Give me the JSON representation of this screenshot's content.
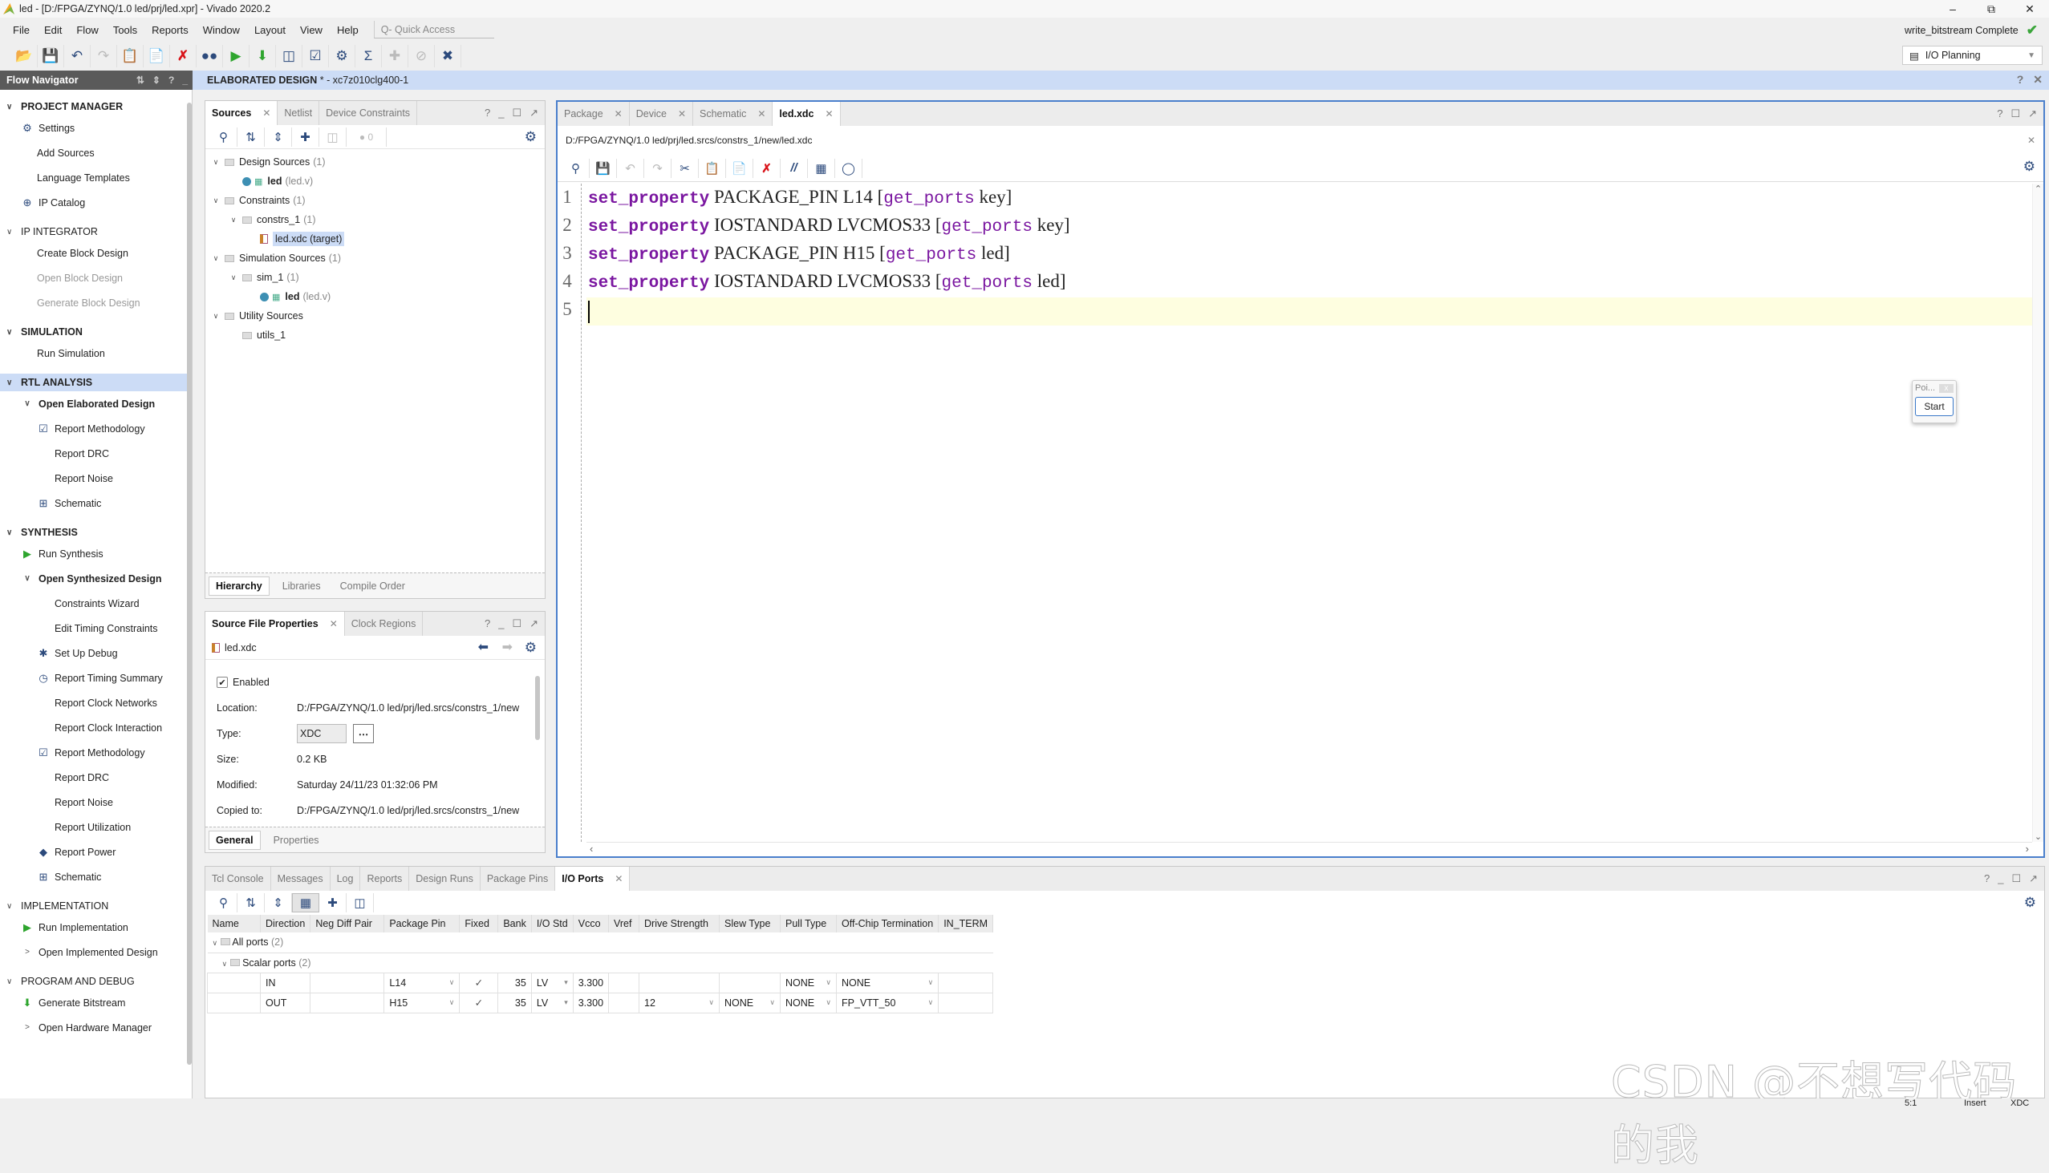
{
  "window": {
    "title": "led - [D:/FPGA/ZYNQ/1.0 led/prj/led.xpr] - Vivado 2020.2",
    "controls": [
      "minimize-icon",
      "restore-icon",
      "close-icon"
    ]
  },
  "menu": {
    "items": [
      "File",
      "Edit",
      "Flow",
      "Tools",
      "Reports",
      "Window",
      "Layout",
      "View",
      "Help"
    ],
    "quick_access_placeholder": "Q- Quick Access"
  },
  "status": {
    "run_status": "write_bitstream Complete",
    "layout_selector": "I/O Planning"
  },
  "toolbar": {
    "buttons": [
      "open-project",
      "save",
      "undo",
      "redo",
      "copy",
      "paste",
      "delete",
      "find",
      "run",
      "generate-bitstream",
      "schematic",
      "report",
      "settings",
      "sigma",
      "disabled-1",
      "disabled-2",
      "close-design"
    ]
  },
  "header": {
    "flow_navigator": "Flow Navigator",
    "design_title": "ELABORATED DESIGN",
    "design_part": " * - xc7z010clg400-1"
  },
  "flow_navigator": {
    "sections": [
      {
        "title": "PROJECT MANAGER",
        "items": [
          {
            "label": "Settings",
            "icon": "gear-icon"
          },
          {
            "label": "Add Sources"
          },
          {
            "label": "Language Templates"
          },
          {
            "label": "IP Catalog",
            "icon": "ip-icon"
          }
        ]
      },
      {
        "title": "IP INTEGRATOR",
        "items": [
          {
            "label": "Create Block Design"
          },
          {
            "label": "Open Block Design",
            "disabled": true
          },
          {
            "label": "Generate Block Design",
            "disabled": true
          }
        ]
      },
      {
        "title": "SIMULATION",
        "items": [
          {
            "label": "Run Simulation"
          }
        ]
      },
      {
        "title": "RTL ANALYSIS",
        "active": true,
        "items": [
          {
            "label": "Open Elaborated Design",
            "expanded": true
          },
          {
            "label": "Report Methodology",
            "icon": "clipboard-icon"
          },
          {
            "label": "Report DRC"
          },
          {
            "label": "Report Noise"
          },
          {
            "label": "Schematic",
            "icon": "schematic-icon"
          }
        ]
      },
      {
        "title": "SYNTHESIS",
        "items": [
          {
            "label": "Run Synthesis",
            "icon": "play-icon"
          },
          {
            "label": "Open Synthesized Design",
            "expanded": true
          },
          {
            "label": "Constraints Wizard"
          },
          {
            "label": "Edit Timing Constraints"
          },
          {
            "label": "Set Up Debug",
            "icon": "bug-icon"
          },
          {
            "label": "Report Timing Summary",
            "icon": "clock-icon"
          },
          {
            "label": "Report Clock Networks"
          },
          {
            "label": "Report Clock Interaction"
          },
          {
            "label": "Report Methodology",
            "icon": "clipboard-icon"
          },
          {
            "label": "Report DRC"
          },
          {
            "label": "Report Noise"
          },
          {
            "label": "Report Utilization"
          },
          {
            "label": "Report Power",
            "icon": "power-icon"
          },
          {
            "label": "Schematic",
            "icon": "schematic-icon"
          }
        ]
      },
      {
        "title": "IMPLEMENTATION",
        "items": [
          {
            "label": "Run Implementation",
            "icon": "play-icon"
          },
          {
            "label": "Open Implemented Design",
            "collapsed": true
          }
        ]
      },
      {
        "title": "PROGRAM AND DEBUG",
        "items": [
          {
            "label": "Generate Bitstream",
            "icon": "bitstream-icon"
          },
          {
            "label": "Open Hardware Manager",
            "collapsed": true
          }
        ]
      }
    ]
  },
  "sources": {
    "tabs": [
      "Sources",
      "Netlist",
      "Device Constraints"
    ],
    "active_tab": "Sources",
    "warning_count": "0",
    "tree": {
      "design_sources": {
        "label": "Design Sources",
        "count": "(1)"
      },
      "design_led": {
        "name": "led",
        "file": "(led.v)"
      },
      "constraints": {
        "label": "Constraints",
        "count": "(1)"
      },
      "constrs_1": {
        "label": "constrs_1",
        "count": "(1)"
      },
      "led_xdc": {
        "label": "led.xdc (target)"
      },
      "simulation_sources": {
        "label": "Simulation Sources",
        "count": "(1)"
      },
      "sim_1": {
        "label": "sim_1",
        "count": "(1)"
      },
      "sim_led": {
        "name": "led",
        "file": "(led.v)"
      },
      "utility_sources": {
        "label": "Utility Sources"
      },
      "utils_1": {
        "label": "utils_1"
      }
    },
    "bottom_tabs": [
      "Hierarchy",
      "Libraries",
      "Compile Order"
    ]
  },
  "properties": {
    "tabs": [
      "Source File Properties",
      "Clock Regions"
    ],
    "file": "led.xdc",
    "enabled_label": "Enabled",
    "enabled": true,
    "rows": [
      {
        "key": "Location:",
        "value": "D:/FPGA/ZYNQ/1.0 led/prj/led.srcs/constrs_1/new"
      },
      {
        "key": "Type:",
        "value": "XDC"
      },
      {
        "key": "Size:",
        "value": "0.2 KB"
      },
      {
        "key": "Modified:",
        "value": "Saturday 24/11/23 01:32:06 PM"
      },
      {
        "key": "Copied to:",
        "value": "D:/FPGA/ZYNQ/1.0 led/prj/led.srcs/constrs_1/new"
      }
    ],
    "bottom_tabs": [
      "General",
      "Properties"
    ]
  },
  "editor": {
    "tabs": [
      "Package",
      "Device",
      "Schematic",
      "led.xdc"
    ],
    "active_tab": "led.xdc",
    "path": "D:/FPGA/ZYNQ/1.0 led/prj/led.srcs/constrs_1/new/led.xdc",
    "lines": [
      {
        "n": "1",
        "cmd": "set_property",
        "mid": " PACKAGE_PIN L14 [",
        "fn": "get_ports",
        "end": " key]"
      },
      {
        "n": "2",
        "cmd": "set_property",
        "mid": " IOSTANDARD LVCMOS33 [",
        "fn": "get_ports",
        "end": " key]"
      },
      {
        "n": "3",
        "cmd": "set_property",
        "mid": " PACKAGE_PIN H15 [",
        "fn": "get_ports",
        "end": " led]"
      },
      {
        "n": "4",
        "cmd": "set_property",
        "mid": " IOSTANDARD LVCMOS33 [",
        "fn": "get_ports",
        "end": " led]"
      },
      {
        "n": "5",
        "cmd": "",
        "mid": "",
        "fn": "",
        "end": ""
      }
    ]
  },
  "popup": {
    "title": "Poi...",
    "button": "Start"
  },
  "bottom_panel": {
    "tabs": [
      "Tcl Console",
      "Messages",
      "Log",
      "Reports",
      "Design Runs",
      "Package Pins",
      "I/O Ports"
    ],
    "active_tab": "I/O Ports",
    "columns": [
      "Name",
      "Direction",
      "Neg Diff Pair",
      "Package Pin",
      "Fixed",
      "Bank",
      "I/O Std",
      "Vcco",
      "Vref",
      "Drive Strength",
      "Slew Type",
      "Pull Type",
      "Off-Chip Termination",
      "IN_TERM"
    ],
    "groups": {
      "all_ports": "All ports",
      "all_count": "(2)",
      "scalar_ports": "Scalar ports",
      "scalar_count": "(2)"
    },
    "rows": [
      {
        "name": "",
        "direction": "IN",
        "neg_diff_pair": "",
        "package_pin": "L14",
        "fixed": "✓",
        "bank": "35",
        "io_std": "LV",
        "vcco": "3.300",
        "vref": "",
        "drive_strength": "",
        "slew_type": "",
        "pull_type": "NONE",
        "off_chip_termination": "NONE",
        "in_term": ""
      },
      {
        "name": "",
        "direction": "OUT",
        "neg_diff_pair": "",
        "package_pin": "H15",
        "fixed": "✓",
        "bank": "35",
        "io_std": "LV",
        "vcco": "3.300",
        "vref": "",
        "drive_strength": "12",
        "slew_type": "NONE",
        "pull_type": "NONE",
        "off_chip_termination": "FP_VTT_50",
        "in_term": ""
      }
    ]
  },
  "statusbar": {
    "position": "5:1",
    "mode": "Insert",
    "filetype": "XDC"
  },
  "watermark": "CSDN @不想写代码的我"
}
